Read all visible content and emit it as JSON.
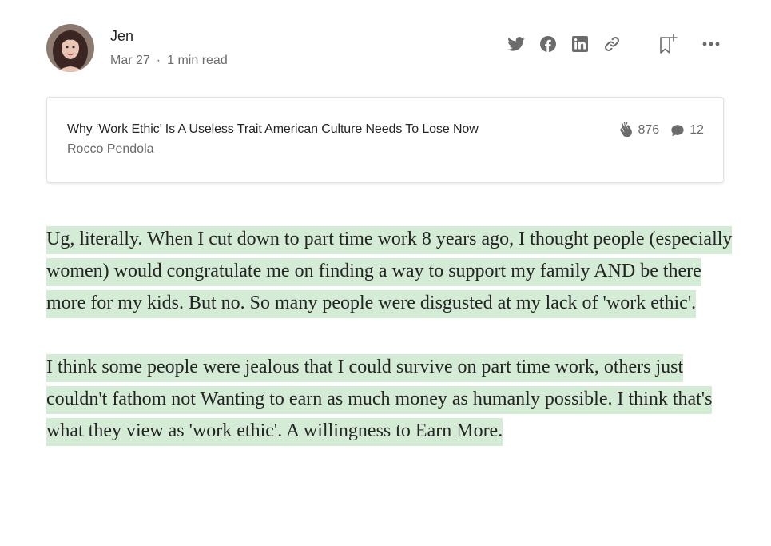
{
  "author": {
    "name": "Jen",
    "avatar_icon": "avatar-portrait-icon"
  },
  "meta": {
    "date": "Mar 27",
    "separator": "·",
    "read_time": "1 min read"
  },
  "share_icons": [
    "twitter-icon",
    "facebook-icon",
    "linkedin-icon",
    "link-icon",
    "bookmark-add-icon",
    "more-icon"
  ],
  "card": {
    "title": "Why ‘Work Ethic’ Is A Useless Trait American Culture Needs To Lose Now",
    "author": "Rocco Pendola",
    "claps": "876",
    "responses": "12"
  },
  "body": {
    "paragraphs": [
      "Ug, literally. When I cut down to part time work 8 years ago, I thought people (especially women) would congratulate me on finding a way to support my family AND be there more for my kids. But no. So many people were disgusted at my lack of 'work ethic'.",
      "I think some people were jealous that I could survive on part time work, others just couldn't fathom not Wanting to earn as much money as humanly possible. I think that's what they view as 'work ethic'. A willingness to Earn More."
    ]
  },
  "colors": {
    "highlight": "#d4ebd6",
    "text": "#242424",
    "muted": "#6b6b6b",
    "icon": "#6b6b6b"
  }
}
